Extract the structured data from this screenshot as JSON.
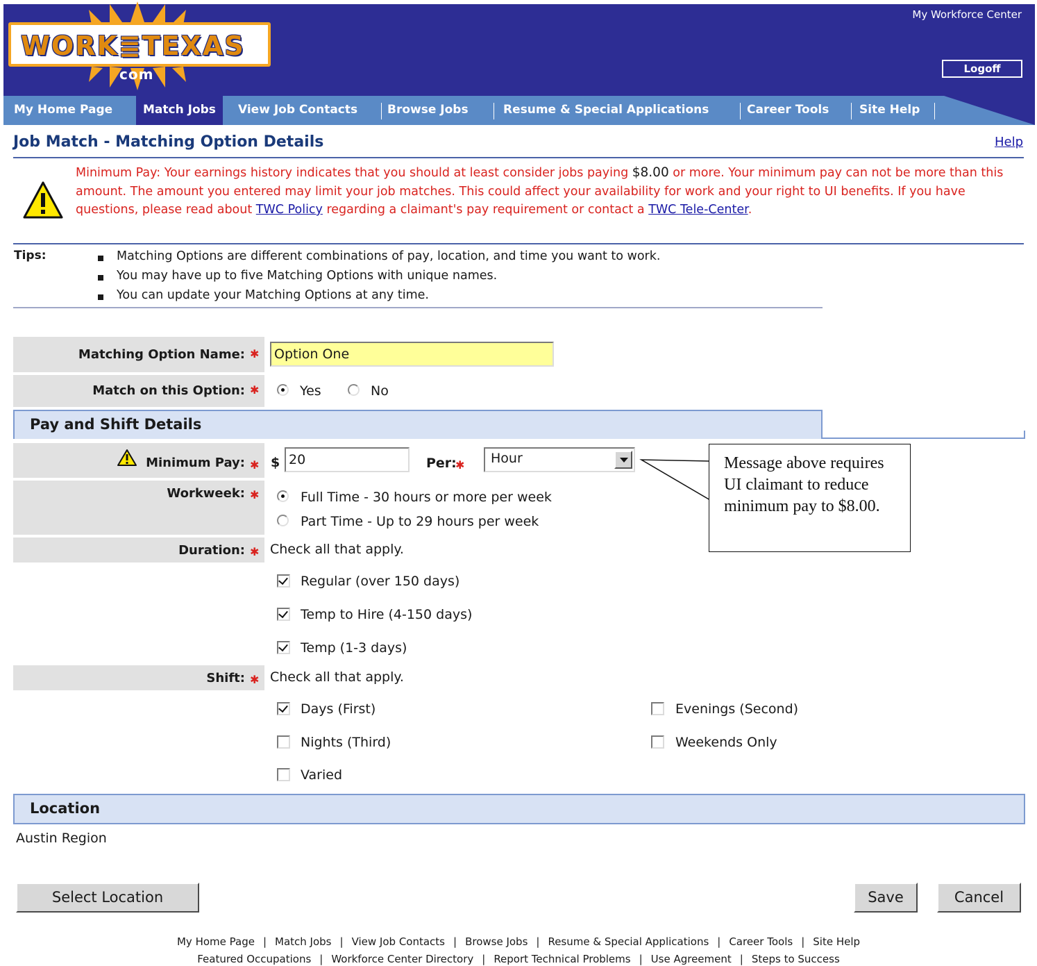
{
  "header": {
    "logo_main": "WORK≣TEXAS",
    "logo_sub": "com",
    "top_right_link": "My Workforce Center",
    "logoff_label": "Logoff"
  },
  "nav": {
    "items": [
      {
        "label": "My Home Page"
      },
      {
        "label": "Match Jobs"
      },
      {
        "label": "View Job Contacts"
      },
      {
        "label": "Browse Jobs"
      },
      {
        "label": "Resume & Special Applications"
      },
      {
        "label": "Career Tools"
      },
      {
        "label": "Site Help"
      }
    ],
    "active": "Match Jobs"
  },
  "page": {
    "title": "Job Match - Matching Option Details",
    "help_label": "Help"
  },
  "warning": {
    "part1": "Minimum Pay: Your earnings history indicates that you should at least consider jobs paying ",
    "amount": "$8.00",
    "part2": " or more. Your minimum pay can not be more than this amount. The amount you entered may limit your job matches. This could affect your availability for work and your right to UI benefits. If you have questions, please read about ",
    "link1": "TWC Policy",
    "part3": " regarding a claimant's pay requirement or contact a ",
    "link2": "TWC Tele-Center",
    "part4": "."
  },
  "tips": {
    "label": "Tips:",
    "items": [
      "Matching Options are different combinations of pay, location, and time you want to work.",
      "You may have up to five Matching Options with unique names.",
      "You can update your Matching Options at any time."
    ]
  },
  "form": {
    "name_label": "Matching Option Name:",
    "name_value": "Option One",
    "match_label": "Match on this Option:",
    "match_yes": "Yes",
    "match_no": "No",
    "pay_section": "Pay and Shift Details",
    "min_pay_label": "Minimum Pay:",
    "currency": "$",
    "min_pay_value": "20",
    "per_label": "Per:",
    "per_value": "Hour",
    "workweek_label": "Workweek:",
    "workweek_full": "Full Time - 30 hours or more per week",
    "workweek_part": "Part Time - Up to 29 hours per week",
    "duration_label": "Duration:",
    "duration_hint": "Check all that apply.",
    "duration_options": [
      {
        "label": "Regular (over 150 days)",
        "checked": true
      },
      {
        "label": "Temp to Hire (4-150 days)",
        "checked": true
      },
      {
        "label": "Temp (1-3 days)",
        "checked": true
      }
    ],
    "shift_label": "Shift:",
    "shift_hint": "Check all that apply.",
    "shift_options": [
      {
        "label": "Days (First)",
        "checked": true
      },
      {
        "label": "Evenings (Second)",
        "checked": false
      },
      {
        "label": "Nights (Third)",
        "checked": false
      },
      {
        "label": "Weekends Only",
        "checked": false
      },
      {
        "label": "Varied",
        "checked": false
      }
    ],
    "location_section": "Location",
    "location_value": "Austin Region",
    "select_location_label": "Select Location",
    "save_label": "Save",
    "cancel_label": "Cancel"
  },
  "callout": {
    "text": "Message above requires UI claimant to reduce minimum pay to $8.00."
  },
  "footer": {
    "row1": [
      "My Home Page",
      "Match Jobs",
      "View Job Contacts",
      "Browse Jobs",
      "Resume & Special Applications",
      "Career Tools",
      "Site Help"
    ],
    "row2": [
      "Featured Occupations",
      "Workforce Center Directory",
      "Report Technical Problems",
      "Use Agreement",
      "Steps to Success"
    ]
  },
  "colors": {
    "header_blue": "#2d2d94",
    "nav_blue": "#5a8ac6",
    "warning_red": "#d9231f",
    "section_fill": "#d8e2f4",
    "highlight_input": "#ffff99"
  }
}
